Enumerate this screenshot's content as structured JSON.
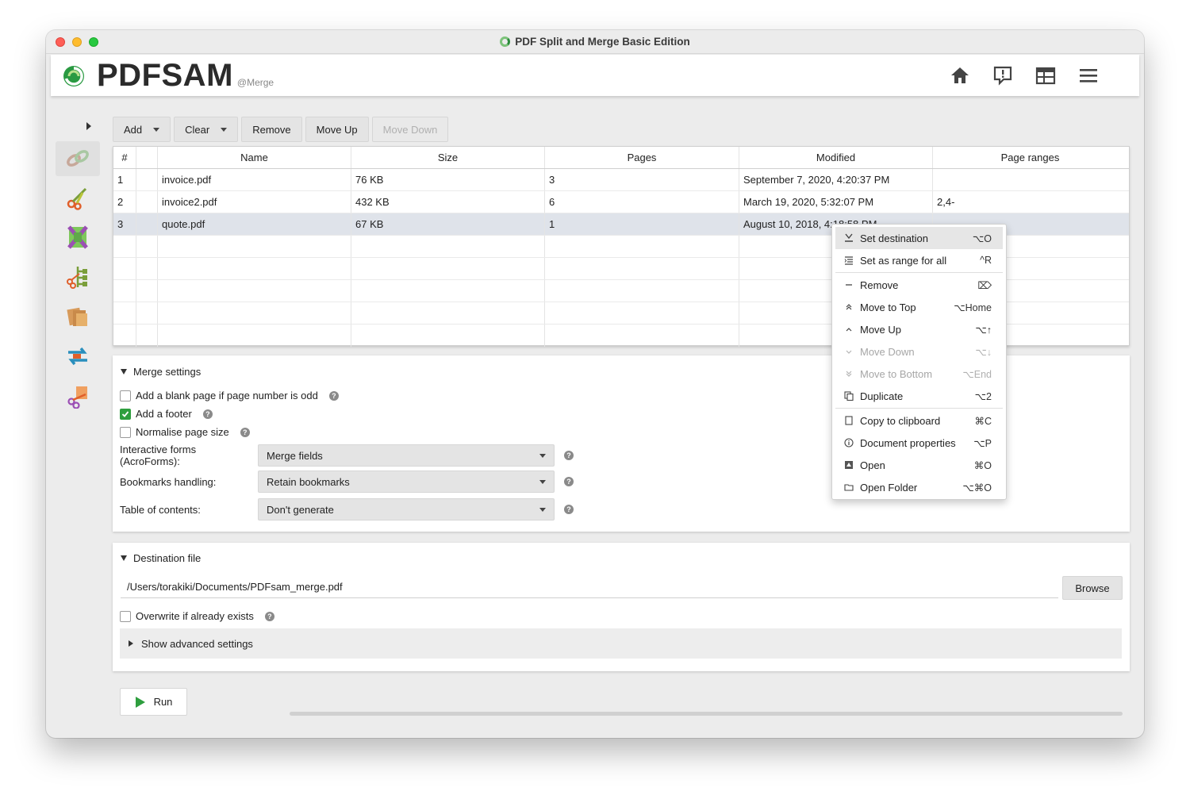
{
  "window": {
    "title": "PDF Split and Merge Basic Edition"
  },
  "header": {
    "logo_text": "PDFSAM",
    "logo_sub": "@Merge",
    "icons": [
      "home-icon",
      "feedback-icon",
      "dashboard-icon",
      "menu-icon"
    ]
  },
  "sidebar": {
    "items": [
      "merge-icon",
      "split-icon",
      "alternate-mix-icon",
      "split-by-bookmarks-icon",
      "extract-icon",
      "rotate-icon",
      "split-by-size-icon"
    ],
    "active": "merge-icon"
  },
  "toolbar": {
    "add": "Add",
    "clear": "Clear",
    "remove": "Remove",
    "move_up": "Move Up",
    "move_down": "Move Down"
  },
  "table": {
    "columns": [
      "#",
      "",
      "Name",
      "Size",
      "Pages",
      "Modified",
      "Page ranges"
    ],
    "rows": [
      {
        "num": "1",
        "name": "invoice.pdf",
        "size": "76 KB",
        "pages": "3",
        "modified": "September 7, 2020, 4:20:37 PM",
        "ranges": ""
      },
      {
        "num": "2",
        "name": "invoice2.pdf",
        "size": "432 KB",
        "pages": "6",
        "modified": "March 19, 2020, 5:32:07 PM",
        "ranges": "2,4-"
      },
      {
        "num": "3",
        "name": "quote.pdf",
        "size": "67 KB",
        "pages": "1",
        "modified": "August 10, 2018, 4:18:58 PM",
        "ranges": ""
      }
    ]
  },
  "context_menu": {
    "set_destination": {
      "label": "Set destination",
      "shortcut": "⌥O"
    },
    "set_range_all": {
      "label": "Set as range for all",
      "shortcut": "^R"
    },
    "remove": {
      "label": "Remove",
      "shortcut": "⌦"
    },
    "move_top": {
      "label": "Move to Top",
      "shortcut": "⌥Home"
    },
    "move_up": {
      "label": "Move Up",
      "shortcut": "⌥↑"
    },
    "move_down": {
      "label": "Move Down",
      "shortcut": "⌥↓"
    },
    "move_bottom": {
      "label": "Move to Bottom",
      "shortcut": "⌥End"
    },
    "duplicate": {
      "label": "Duplicate",
      "shortcut": "⌥2"
    },
    "copy": {
      "label": "Copy to clipboard",
      "shortcut": "⌘C"
    },
    "properties": {
      "label": "Document properties",
      "shortcut": "⌥P"
    },
    "open": {
      "label": "Open",
      "shortcut": "⌘O"
    },
    "open_folder": {
      "label": "Open Folder",
      "shortcut": "⌥⌘O"
    }
  },
  "merge_settings": {
    "title": "Merge settings",
    "blank_page": {
      "label": "Add a blank page if page number is odd",
      "checked": false
    },
    "footer": {
      "label": "Add a footer",
      "checked": true
    },
    "normalise": {
      "label": "Normalise page size",
      "checked": false
    },
    "acroforms": {
      "label": "Interactive forms (AcroForms):",
      "value": "Merge fields"
    },
    "bookmarks": {
      "label": "Bookmarks handling:",
      "value": "Retain bookmarks"
    },
    "toc": {
      "label": "Table of contents:",
      "value": "Don't generate"
    }
  },
  "destination": {
    "title": "Destination file",
    "path": "/Users/torakiki/Documents/PDFsam_merge.pdf",
    "browse": "Browse",
    "overwrite": {
      "label": "Overwrite if already exists",
      "checked": false
    },
    "advanced": "Show advanced settings"
  },
  "run": {
    "label": "Run"
  },
  "colors": {
    "accent_green": "#2e9e3e",
    "selection": "#dfe3ea"
  }
}
